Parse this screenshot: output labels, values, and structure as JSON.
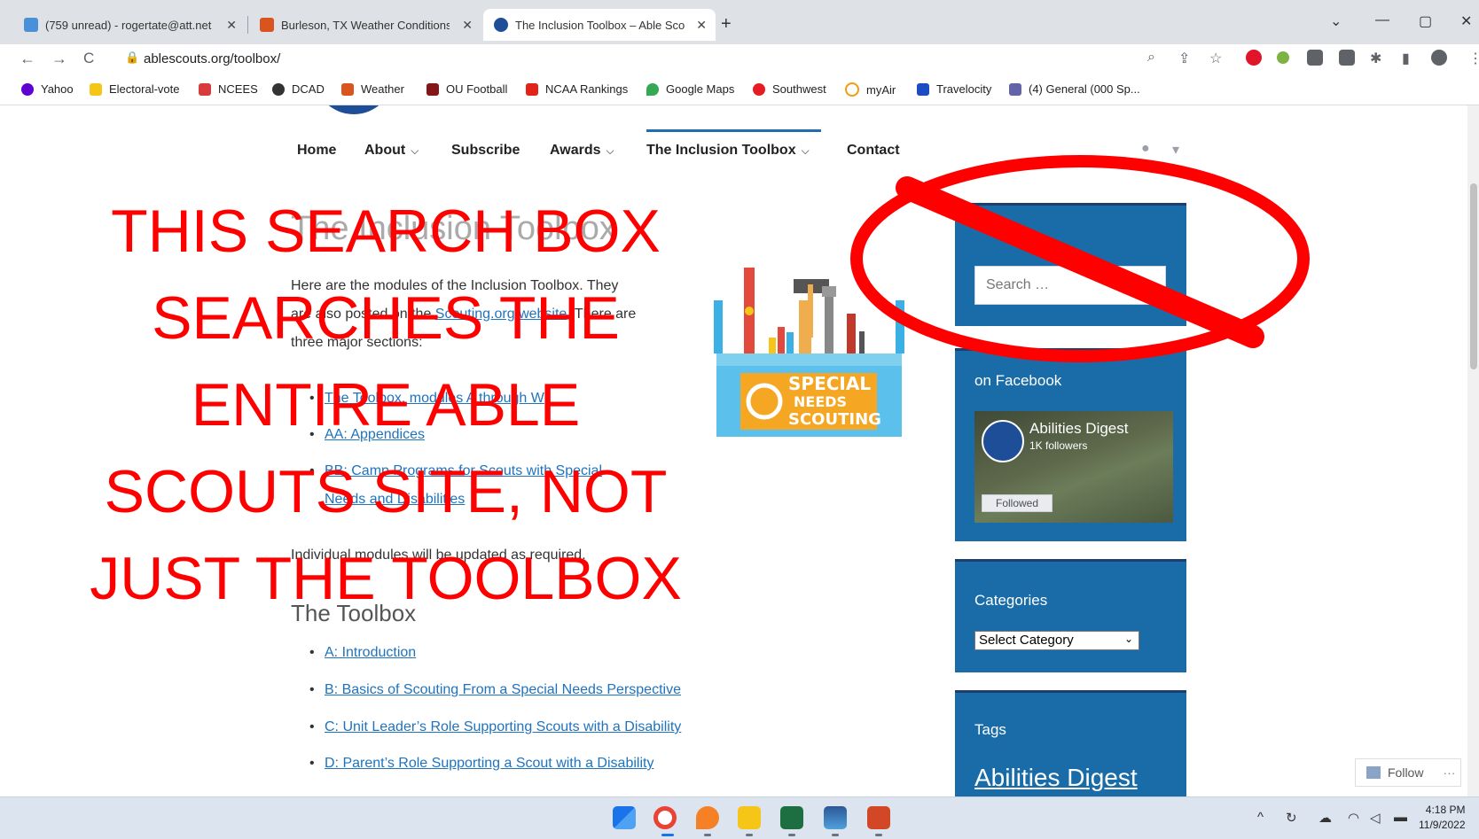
{
  "browser": {
    "tabs": [
      {
        "title": "(759 unread) - rogertate@att.net",
        "close": "✕"
      },
      {
        "title": "Burleson, TX Weather Conditions",
        "close": "✕"
      },
      {
        "title": "The Inclusion Toolbox – Able Scouts",
        "close": "✕"
      }
    ],
    "new_tab": "+",
    "window_controls": {
      "dropdown": "⌄",
      "minimize": "—",
      "restore": "▢",
      "close": "✕"
    },
    "url": "ablescouts.org/toolbox/",
    "nav": {
      "back": "←",
      "forward": "→",
      "reload": "C"
    },
    "bookmarks": [
      {
        "label": "Yahoo",
        "color": "#6001d2"
      },
      {
        "label": "Electoral-vote",
        "color": "#f5c518"
      },
      {
        "label": "NCEES",
        "color": "#d83b3b"
      },
      {
        "label": "DCAD",
        "color": "#333333"
      },
      {
        "label": "Weather",
        "color": "#d9541e"
      },
      {
        "label": "OU Football",
        "color": "#841617"
      },
      {
        "label": "NCAA Rankings",
        "color": "#e2231a"
      },
      {
        "label": "Google Maps",
        "color": "#34a853"
      },
      {
        "label": "Southwest",
        "color": "#e51d23"
      },
      {
        "label": "myAir",
        "color": "#f39c12"
      },
      {
        "label": "Travelocity",
        "color": "#1c4bc2"
      },
      {
        "label": "(4) General (000 Sp...",
        "color": "#6264a7"
      }
    ]
  },
  "site": {
    "nav": [
      {
        "label": "Home",
        "has_dropdown": false
      },
      {
        "label": "About",
        "has_dropdown": true
      },
      {
        "label": "Subscribe",
        "has_dropdown": false
      },
      {
        "label": "Awards",
        "has_dropdown": true
      },
      {
        "label": "The Inclusion Toolbox",
        "has_dropdown": true
      },
      {
        "label": "Contact",
        "has_dropdown": false
      }
    ],
    "dropdown_glyph": "⌵",
    "page_title": "The Inclusion Toolbox",
    "intro_1": "Here are the modules of the Inclusion Toolbox. They",
    "intro_2a": "are also posted on the ",
    "intro_link": "Scouting.org website",
    "intro_2b": ". There are",
    "intro_3": "three major sections:",
    "sections": [
      "The Toolbox, modules A through W",
      "AA: Appendices",
      "BB: Camp Programs for Scouts with Special",
      "Needs and Disabilities"
    ],
    "update_note": "Individual modules will be updated as required.",
    "toolbox_heading": "The Toolbox",
    "modules": [
      "A: Introduction",
      "B: Basics of Scouting From a Special Needs Perspective",
      "C: Unit Leader’s Role Supporting Scouts with a Disability",
      "D: Parent’s Role Supporting a Scout with a Disability"
    ],
    "image_text": [
      "SPECIAL",
      "NEEDS",
      "SCOUTING"
    ],
    "sidebar": {
      "search_placeholder": "Search …",
      "facebook_title": "on Facebook",
      "fb_page_name": "Abilities Digest",
      "fb_followers": "1K followers",
      "fb_followed": "Followed",
      "categories_title": "Categories",
      "categories_selected": "Select Category",
      "tags_title": "Tags",
      "tag_link": "Abilities Digest"
    },
    "follow_button": "Follow",
    "follow_more": "···"
  },
  "annotation": {
    "text": "THIS SEARCH BOX\nSEARCHES THE\nENTIRE ABLE\nSCOUTS SITE, NOT\nJUST THE TOOLBOX",
    "color": "#ff0000"
  },
  "taskbar": {
    "time": "4:18 PM",
    "date": "11/9/2022"
  }
}
